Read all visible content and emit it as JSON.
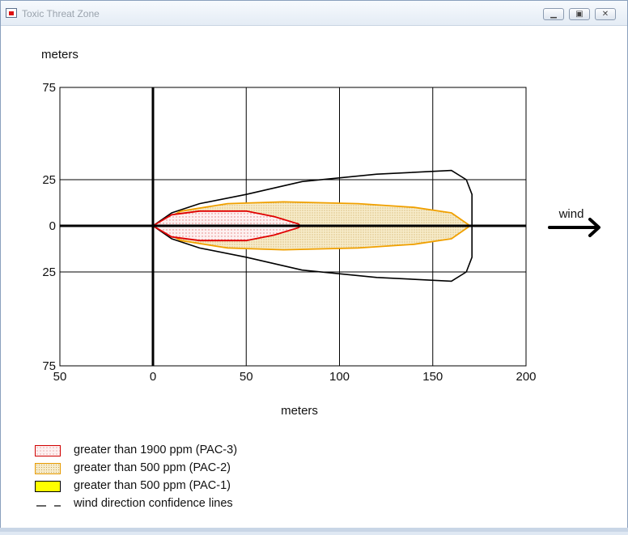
{
  "window": {
    "title": "Toxic Threat Zone",
    "buttons": [
      "minimize",
      "maximize",
      "close"
    ]
  },
  "chart_data": {
    "type": "area",
    "ylabel": "meters",
    "xlabel": "meters",
    "x_ticks": [
      "50",
      "0",
      "50",
      "100",
      "150",
      "200"
    ],
    "y_ticks": [
      "75",
      "25",
      "0",
      "25",
      "75"
    ],
    "xlim": [
      -50,
      200
    ],
    "ylim": [
      -75,
      75
    ],
    "grid": true,
    "wind_label": "wind",
    "series": [
      {
        "name": "greater than 1900 ppm (PAC-3)",
        "color": "#e00000",
        "fill": "dotted-pink",
        "outline": [
          [
            0,
            0
          ],
          [
            10,
            6
          ],
          [
            25,
            8
          ],
          [
            50,
            8
          ],
          [
            65,
            5
          ],
          [
            78,
            1
          ],
          [
            79,
            0
          ],
          [
            78,
            -1
          ],
          [
            65,
            -5
          ],
          [
            50,
            -8
          ],
          [
            25,
            -8
          ],
          [
            10,
            -6
          ],
          [
            0,
            0
          ]
        ]
      },
      {
        "name": "greater than 500 ppm (PAC-2)",
        "color": "#f0a000",
        "fill": "dotted-tan",
        "outline": [
          [
            0,
            0
          ],
          [
            15,
            8
          ],
          [
            40,
            12
          ],
          [
            70,
            13
          ],
          [
            110,
            12
          ],
          [
            140,
            10
          ],
          [
            160,
            7
          ],
          [
            170,
            0
          ],
          [
            160,
            -7
          ],
          [
            140,
            -10
          ],
          [
            110,
            -12
          ],
          [
            70,
            -13
          ],
          [
            40,
            -12
          ],
          [
            15,
            -8
          ],
          [
            0,
            0
          ]
        ]
      },
      {
        "name": "wind direction confidence lines",
        "color": "#000000",
        "style": "solid",
        "outline": [
          [
            0,
            0
          ],
          [
            10,
            7
          ],
          [
            25,
            12
          ],
          [
            50,
            17
          ],
          [
            80,
            24
          ],
          [
            120,
            28
          ],
          [
            160,
            30
          ],
          [
            168,
            25
          ],
          [
            171,
            17
          ],
          [
            171,
            0
          ],
          [
            171,
            -17
          ],
          [
            168,
            -25
          ],
          [
            160,
            -30
          ],
          [
            120,
            -28
          ],
          [
            80,
            -24
          ],
          [
            50,
            -17
          ],
          [
            25,
            -12
          ],
          [
            10,
            -7
          ],
          [
            0,
            0
          ]
        ]
      }
    ]
  },
  "legend": [
    {
      "label": "greater than 1900 ppm (PAC-3)",
      "swatch": "pac3"
    },
    {
      "label": "greater than 500 ppm (PAC-2)",
      "swatch": "pac2"
    },
    {
      "label": "greater than 500 ppm (PAC-1)",
      "swatch": "pac1"
    },
    {
      "label": "wind direction confidence lines",
      "swatch": "dash"
    }
  ],
  "colors": {
    "pac3_line": "#e00000",
    "pac3_fill": "#fbe4e4",
    "pac2_line": "#f0a000",
    "pac2_fill": "#f6e9c4",
    "pac1_fill": "#ffff00",
    "confidence_line": "#000000"
  }
}
